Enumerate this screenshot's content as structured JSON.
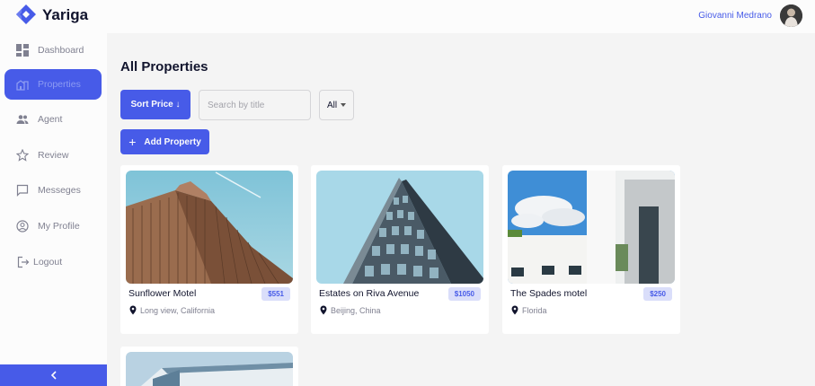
{
  "header": {
    "brand": "Yariga",
    "user_name": "Giovanni Medrano"
  },
  "sidebar": {
    "items": [
      {
        "label": "Dashboard",
        "icon": "dashboard-icon",
        "active": false
      },
      {
        "label": "Properties",
        "icon": "building-icon",
        "active": true
      },
      {
        "label": "Agent",
        "icon": "people-icon",
        "active": false
      },
      {
        "label": "Review",
        "icon": "star-icon",
        "active": false
      },
      {
        "label": "Messeges",
        "icon": "chat-icon",
        "active": false
      },
      {
        "label": "My Profile",
        "icon": "account-circle-icon",
        "active": false
      },
      {
        "label": "Logout",
        "icon": "logout-icon",
        "active": false
      }
    ],
    "collapse_icon": "chevron-left-icon"
  },
  "main": {
    "title": "All Properties",
    "sort_label": "Sort Price ↓",
    "search_placeholder": "Search by title",
    "filter_value": "All",
    "add_label": "Add Property",
    "add_icon": "plus-icon"
  },
  "properties": [
    {
      "title": "Sunflower Motel",
      "price": "$551",
      "location": "Long view, California"
    },
    {
      "title": "Estates on Riva Avenue",
      "price": "$1050",
      "location": "Beijing, China"
    },
    {
      "title": "The Spades motel",
      "price": "$250",
      "location": "Florida"
    }
  ],
  "colors": {
    "accent": "#475be8",
    "accent_light": "#dadefa",
    "text": "#11142d",
    "muted": "#808191",
    "background": "#f4f4f4",
    "panel": "#fcfcfc"
  }
}
